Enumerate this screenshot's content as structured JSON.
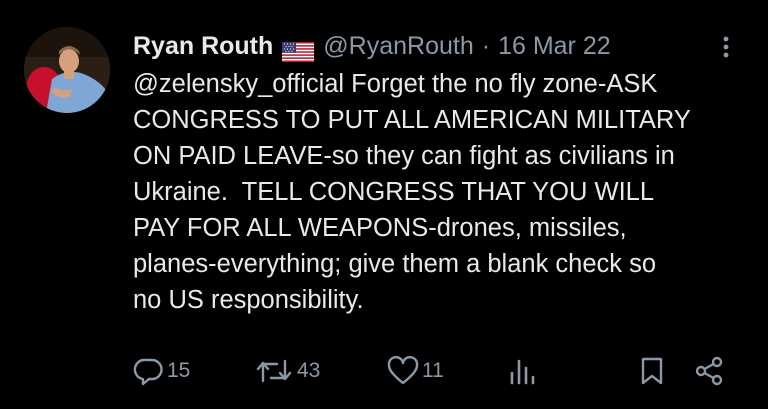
{
  "tweet": {
    "author_name": "Ryan Routh",
    "author_handle": "@RyanRouth",
    "separator": "·",
    "date": "16 Mar 22",
    "flag_icon": "us-flag-icon",
    "text": "@zelensky_official Forget the no fly zone-ASK\nCONGRESS TO PUT ALL AMERICAN MILITARY\nON PAID LEAVE-so they can fight as civilians in\nUkraine.  TELL CONGRESS THAT YOU WILL\nPAY FOR ALL WEAPONS-drones, missiles,\nplanes-everything; give them a blank check so\nno US responsibility.",
    "more_icon": "more-vertical-icon"
  },
  "actions": {
    "reply": {
      "icon": "reply-icon",
      "count": "15"
    },
    "retweet": {
      "icon": "retweet-icon",
      "count": "43"
    },
    "like": {
      "icon": "heart-icon",
      "count": "11"
    },
    "views": {
      "icon": "views-chart-icon"
    },
    "bookmark": {
      "icon": "bookmark-icon"
    },
    "share": {
      "icon": "share-icon"
    }
  },
  "colors": {
    "background": "#000000",
    "text": "#e7e9ea",
    "muted": "#8b98a5"
  }
}
